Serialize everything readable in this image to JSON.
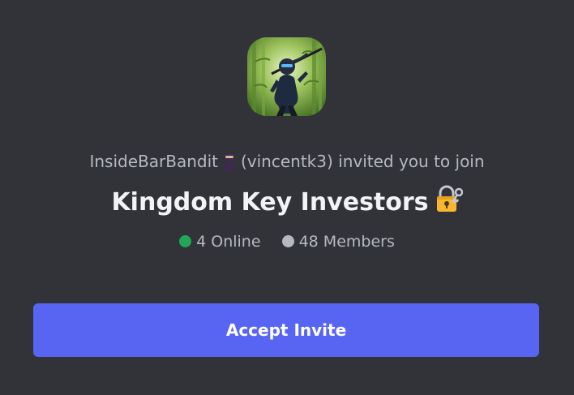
{
  "invite": {
    "inviter_name": "InsideBarBandit",
    "inviter_emoji": "ninja-emoji",
    "inviter_username": "(vincentk3)",
    "invite_text": "invited you to join",
    "server_name": "Kingdom Key Investors",
    "server_emoji": "locked-with-key-emoji",
    "server_icon": "ninja-avatar-icon",
    "online_count": "4 Online",
    "member_count": "48 Members",
    "accept_label": "Accept Invite"
  },
  "colors": {
    "background": "#313338",
    "accept_button": "#5865f2",
    "online_dot": "#23a55a",
    "members_dot": "#b5bac1",
    "title_text": "#f2f3f5",
    "muted_text": "#b5bac1"
  }
}
